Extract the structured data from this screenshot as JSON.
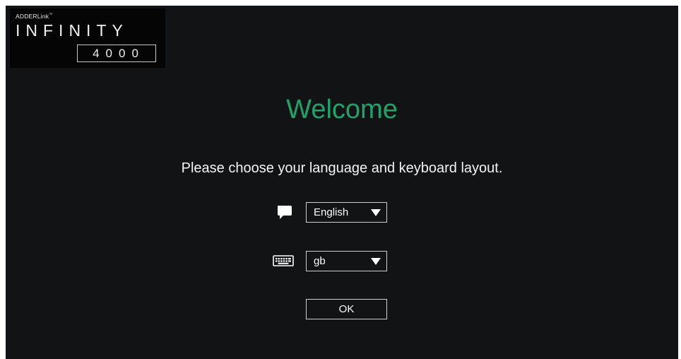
{
  "logo": {
    "brand": "ADDERLink",
    "trademark": "™",
    "product": "INFINITY",
    "model": "4000"
  },
  "welcome_title": "Welcome",
  "prompt": "Please choose your language and keyboard layout.",
  "language_select": {
    "icon": "speech-bubble-icon",
    "selected": "English"
  },
  "keyboard_select": {
    "icon": "keyboard-icon",
    "selected": "gb"
  },
  "ok_label": "OK",
  "colors": {
    "background": "#121315",
    "accent": "#1fa36a",
    "text": "#ffffff"
  }
}
